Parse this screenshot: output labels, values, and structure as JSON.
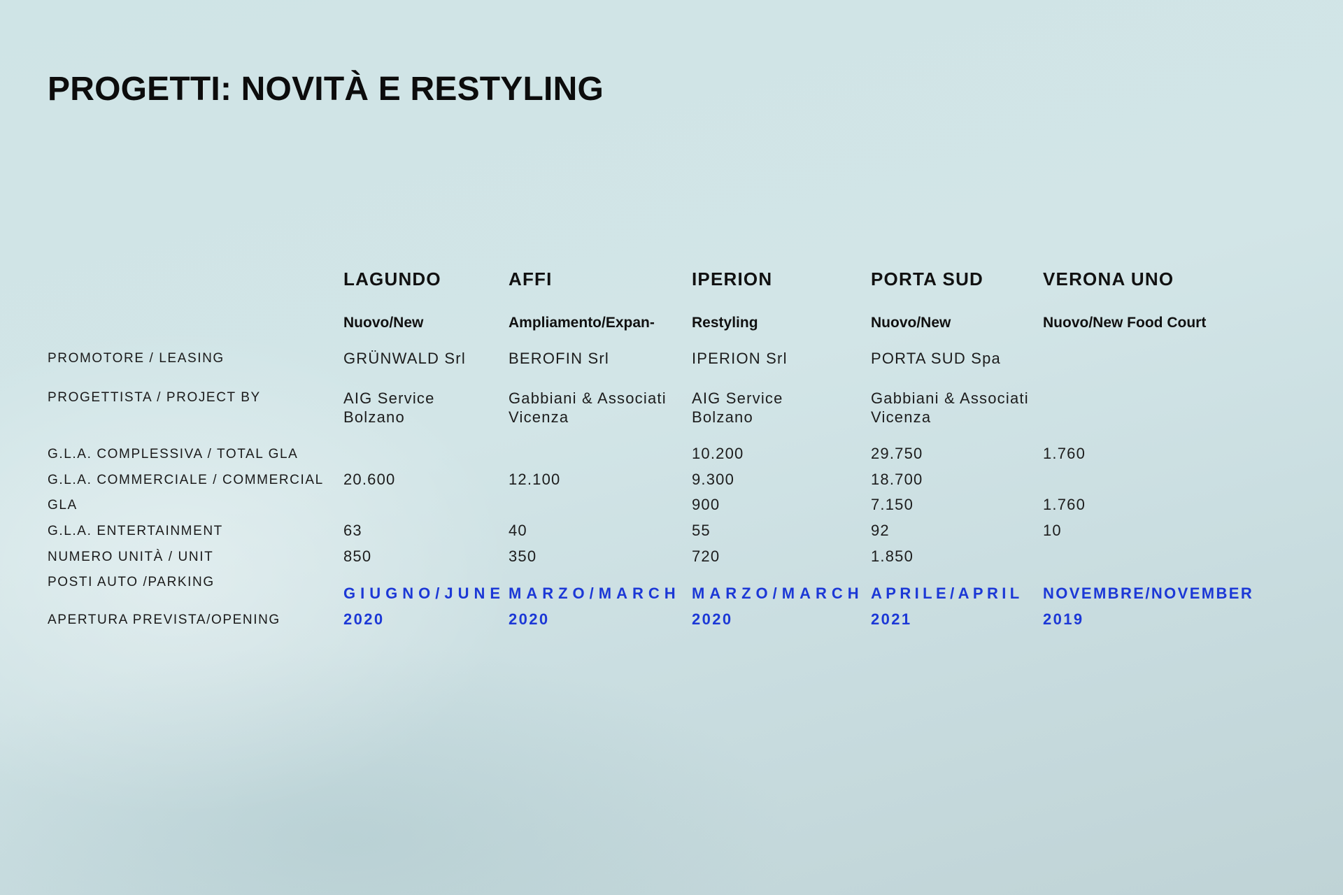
{
  "title": "PROGETTI: NOVITÀ E RESTYLING",
  "row_labels": {
    "promotore": "PROMOTORE / LEASING",
    "progettista": "PROGETTISTA / PROJECT BY",
    "gla_total": "G.L.A. COMPLESSIVA / TOTAL GLA",
    "gla_comm_a": "G.L.A.  COMMERCIALE  /  COMMERCIAL",
    "gla_comm_b": "GLA",
    "gla_ent": "G.L.A. ENTERTAINMENT",
    "units": "NUMERO UNITÀ / UNIT",
    "parking": "POSTI AUTO /PARKING",
    "opening": "APERTURA PREVISTA/OPENING"
  },
  "projects": [
    {
      "name": "LAGUNDO",
      "type": "Nuovo/New",
      "promotore": "GRÜNWALD Srl",
      "progettista_1": "AIG Service",
      "progettista_2": "Bolzano",
      "gla_total": "",
      "gla_commercial": "20.600",
      "gla_entertainment": "",
      "units": "63",
      "parking": "850",
      "opening_1": "GIUGNO/JUNE",
      "opening_2": "2020"
    },
    {
      "name": "AFFI",
      "type": "Ampliamento/Expan-",
      "promotore": "BEROFIN Srl",
      "progettista_1": "Gabbiani & Associati",
      "progettista_2": "Vicenza",
      "gla_total": "",
      "gla_commercial": "12.100",
      "gla_entertainment": "",
      "units": "40",
      "parking": "350",
      "opening_1": "MARZO/MARCH",
      "opening_2": "2020"
    },
    {
      "name": "IPERION",
      "type": "Restyling",
      "promotore": "IPERION Srl",
      "progettista_1": "AIG Service",
      "progettista_2": "Bolzano",
      "gla_total": "10.200",
      "gla_commercial": "9.300",
      "gla_entertainment": "900",
      "units": "55",
      "parking": "720",
      "opening_1": "MARZO/MARCH",
      "opening_2": "2020"
    },
    {
      "name": "PORTA SUD",
      "type": "Nuovo/New",
      "promotore": "PORTA SUD Spa",
      "progettista_1": "Gabbiani & Associati",
      "progettista_2": "Vicenza",
      "gla_total": "29.750",
      "gla_commercial": "18.700",
      "gla_entertainment": "7.150",
      "units": "92",
      "parking": "1.850",
      "opening_1": "APRILE/APRIL",
      "opening_2": "2021"
    },
    {
      "name": "VERONA UNO",
      "type": "Nuovo/New Food Court",
      "promotore": "",
      "progettista_1": "",
      "progettista_2": "",
      "gla_total": "1.760",
      "gla_commercial": "",
      "gla_entertainment": "1.760",
      "units": "10",
      "parking": "",
      "opening_1": "NOVEMBRE/NOVEMBER",
      "opening_2": "2019"
    }
  ]
}
